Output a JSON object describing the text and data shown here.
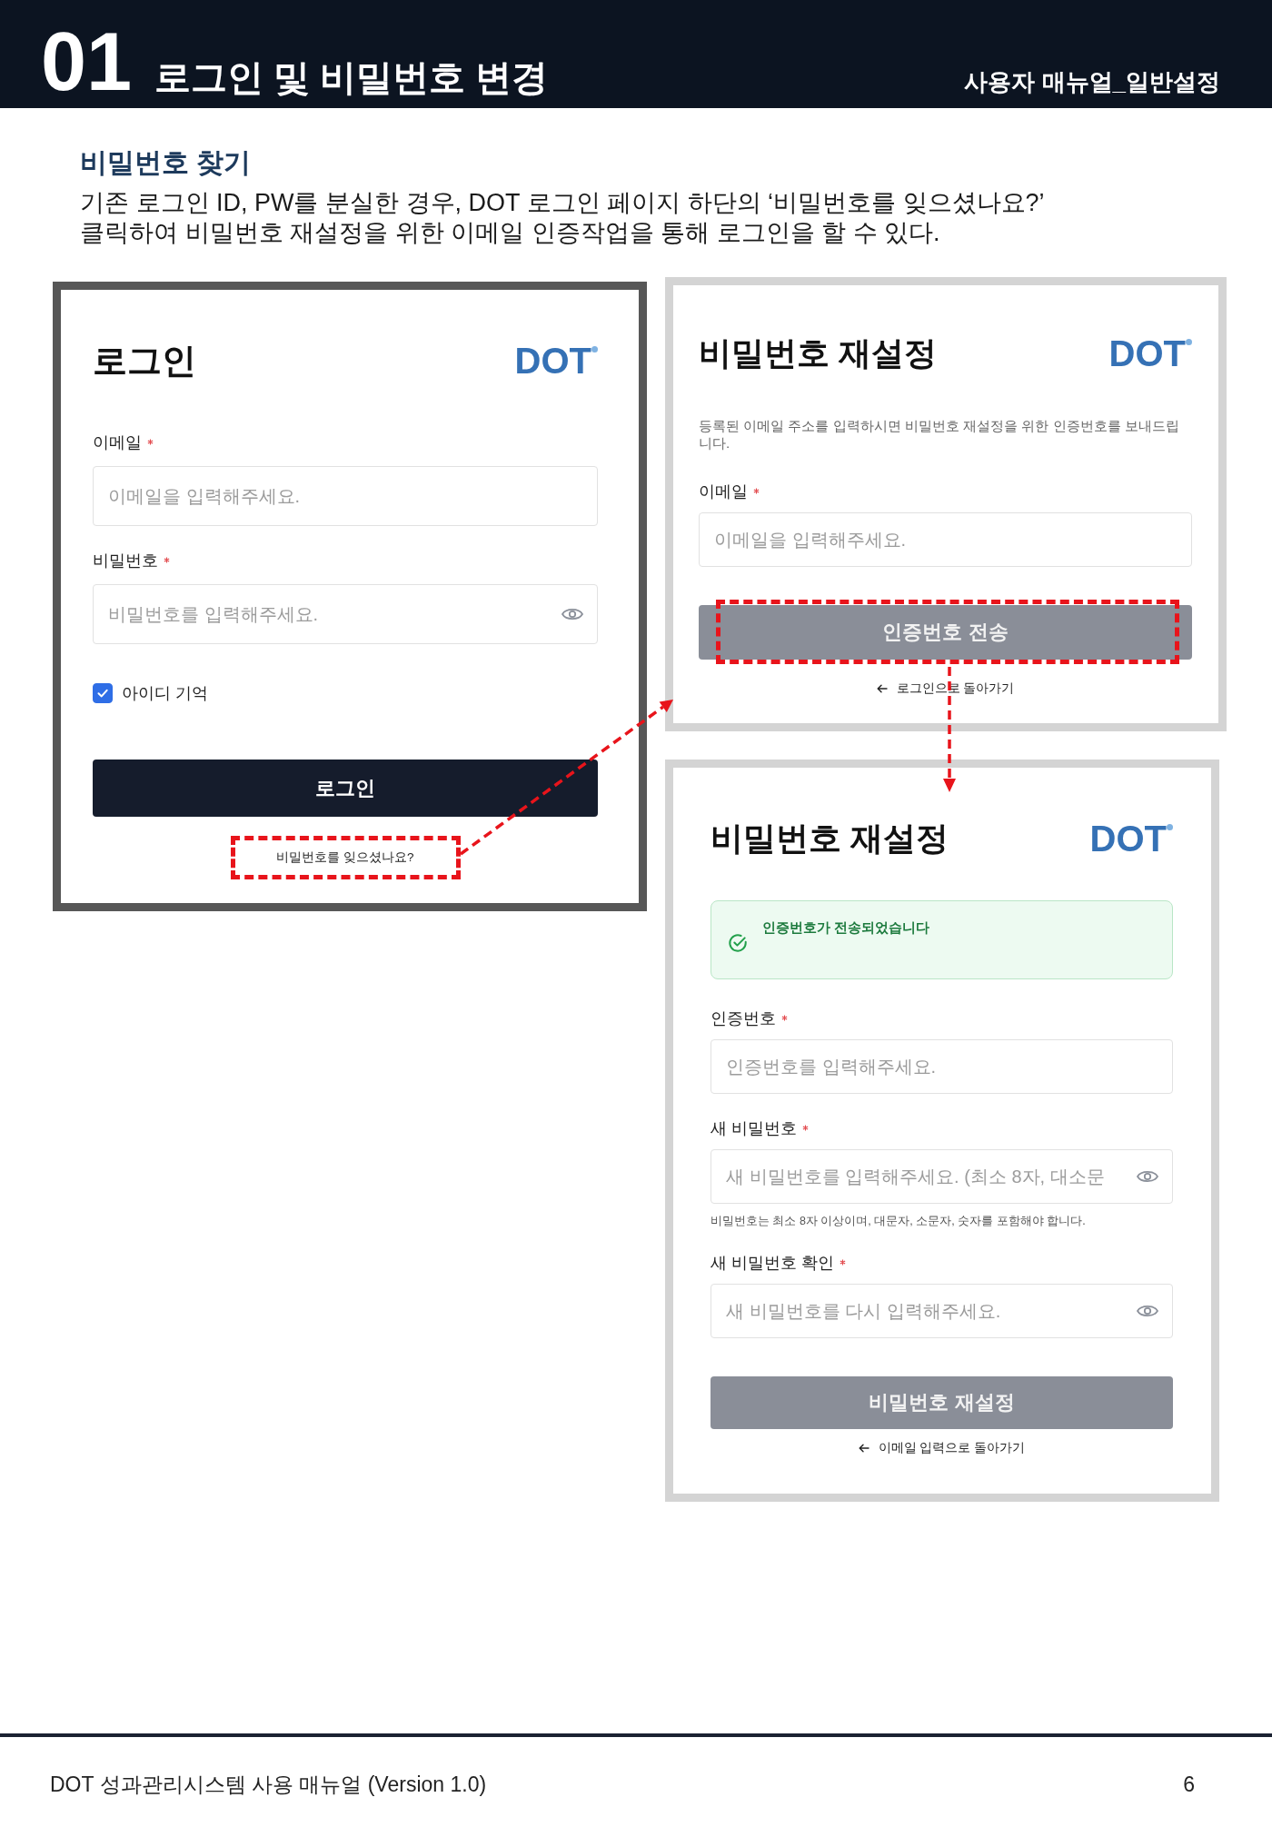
{
  "header": {
    "number": "01",
    "title": "로그인 및 비밀번호 변경",
    "subtitle": "사용자 매뉴얼_일반설정"
  },
  "section": {
    "title": "비밀번호 찾기",
    "description": "기존 로그인 ID, PW를 분실한 경우, DOT 로그인 페이지 하단의 ‘비밀번호를 잊으셨나요?’\n클릭하여 비밀번호 재설정을 위한 이메일 인증작업을 통해 로그인을 할 수 있다."
  },
  "screens": [
    {
      "emphasized": true,
      "title": "로그인",
      "logo": "DOT",
      "fields": [
        {
          "label": "이메일",
          "required": true,
          "placeholder": "이메일을 입력해주세요.",
          "eye_toggle": false
        },
        {
          "label": "비밀번호",
          "required": true,
          "placeholder": "비밀번호를 입력해주세요.",
          "eye_toggle": true
        }
      ],
      "remember": {
        "label": "아이디 기억",
        "checked": true
      },
      "button": {
        "label": "로그인",
        "disabled": false,
        "highlighted": false
      },
      "link": {
        "kind": "forgot",
        "label": "비밀번호를 잊으셨나요?",
        "highlighted": true
      }
    },
    {
      "emphasized": false,
      "title": "비밀번호 재설정",
      "logo": "DOT",
      "description": "등록된 이메일 주소를 입력하시면 비밀번호 재설정을 위한 인증번호를 보내드립니다.",
      "fields": [
        {
          "label": "이메일",
          "required": true,
          "placeholder": "이메일을 입력해주세요.",
          "eye_toggle": false
        }
      ],
      "button": {
        "label": "인증번호 전송",
        "disabled": true,
        "highlighted": true
      },
      "link": {
        "kind": "back",
        "label": "로그인으로 돌아가기",
        "highlighted": false
      }
    },
    {
      "emphasized": false,
      "title": "비밀번호 재설정",
      "logo": "DOT",
      "alert": {
        "kind": "success",
        "text": "인증번호가 전송되었습니다"
      },
      "fields": [
        {
          "label": "인증번호",
          "required": true,
          "placeholder": "인증번호를 입력해주세요.",
          "eye_toggle": false
        },
        {
          "label": "새 비밀번호",
          "required": true,
          "placeholder": "새 비밀번호를 입력해주세요. (최소 8자, 대소문",
          "eye_toggle": true,
          "hint": "비밀번호는 최소 8자 이상이며, 대문자, 소문자, 숫자를 포함해야 합니다."
        },
        {
          "label": "새 비밀번호 확인",
          "required": true,
          "placeholder": "새 비밀번호를 다시 입력해주세요.",
          "eye_toggle": true
        }
      ],
      "button": {
        "label": "비밀번호 재설정",
        "disabled": true,
        "highlighted": false
      },
      "link": {
        "kind": "back",
        "label": "이메일 입력으로 돌아가기",
        "highlighted": false
      }
    }
  ],
  "footer": {
    "text": "DOT 성과관리시스템 사용 매뉴얼 (Version 1.0)",
    "page": "6"
  }
}
